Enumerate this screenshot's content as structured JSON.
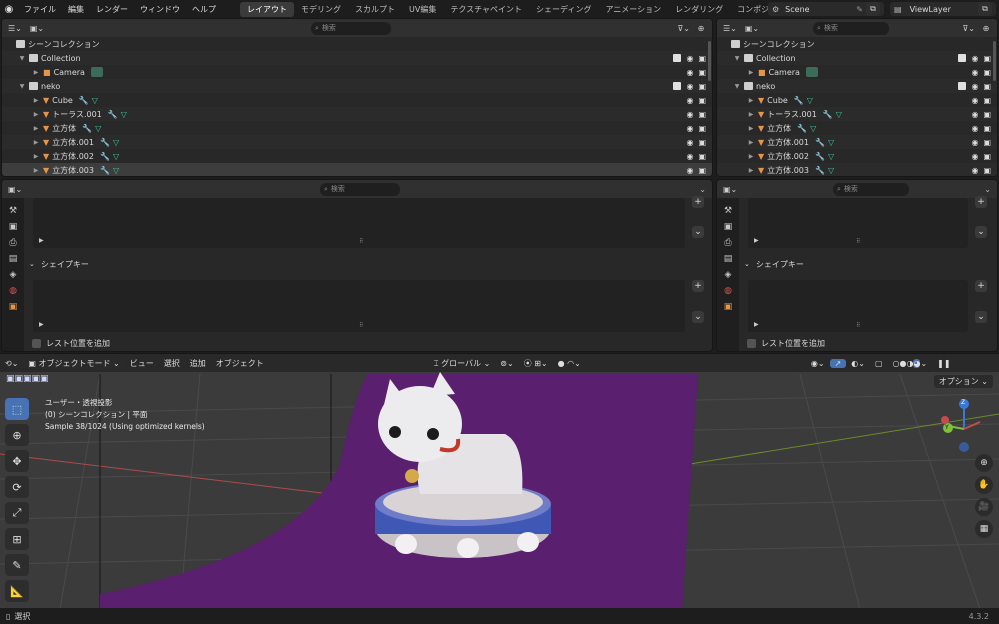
{
  "menu": {
    "items": [
      "ファイル",
      "編集",
      "レンダー",
      "ウィンドウ",
      "ヘルプ"
    ],
    "workspaces": [
      "レイアウト",
      "モデリング",
      "スカルプト",
      "UV編集",
      "テクスチャペイント",
      "シェーディング",
      "アニメーション",
      "レンダリング",
      "コンポジティング"
    ],
    "active_workspace": "レイアウト",
    "scene": "Scene",
    "view_layer": "ViewLayer"
  },
  "outliner": {
    "search_placeholder": "検索",
    "root": "シーンコレクション",
    "rows": [
      {
        "label": "Collection",
        "type": "collection",
        "indent": 1
      },
      {
        "label": "Camera",
        "type": "camera",
        "indent": 2
      },
      {
        "label": "neko",
        "type": "collection",
        "indent": 1
      },
      {
        "label": "Cube",
        "type": "mesh",
        "indent": 2
      },
      {
        "label": "トーラス.001",
        "type": "mesh",
        "indent": 2
      },
      {
        "label": "立方体",
        "type": "mesh",
        "indent": 2
      },
      {
        "label": "立方体.001",
        "type": "mesh",
        "indent": 2
      },
      {
        "label": "立方体.002",
        "type": "mesh",
        "indent": 2
      },
      {
        "label": "立方体.003",
        "type": "mesh",
        "indent": 2
      }
    ]
  },
  "properties": {
    "search_placeholder": "検索",
    "shape_keys": "シェイプキー",
    "add_rest_position": "レスト位置を追加"
  },
  "viewport": {
    "mode": "オブジェクトモード",
    "menu": [
      "ビュー",
      "選択",
      "追加",
      "オブジェクト"
    ],
    "transform_orientation": "グローバル",
    "options_label": "オプション",
    "overlay_line1": "ユーザー・透視投影",
    "overlay_line2": "(0) シーンコレクション | 平面",
    "overlay_line3": "Sample 38/1024 (Using optimized kernels)",
    "gizmo_axes": [
      "Z",
      "Y"
    ]
  },
  "status": {
    "left": "選択",
    "version": "4.3.2"
  },
  "colors": {
    "accent": "#4772b3",
    "mesh_icon": "#e5954a",
    "purple_plane": "#5a1f6e"
  }
}
